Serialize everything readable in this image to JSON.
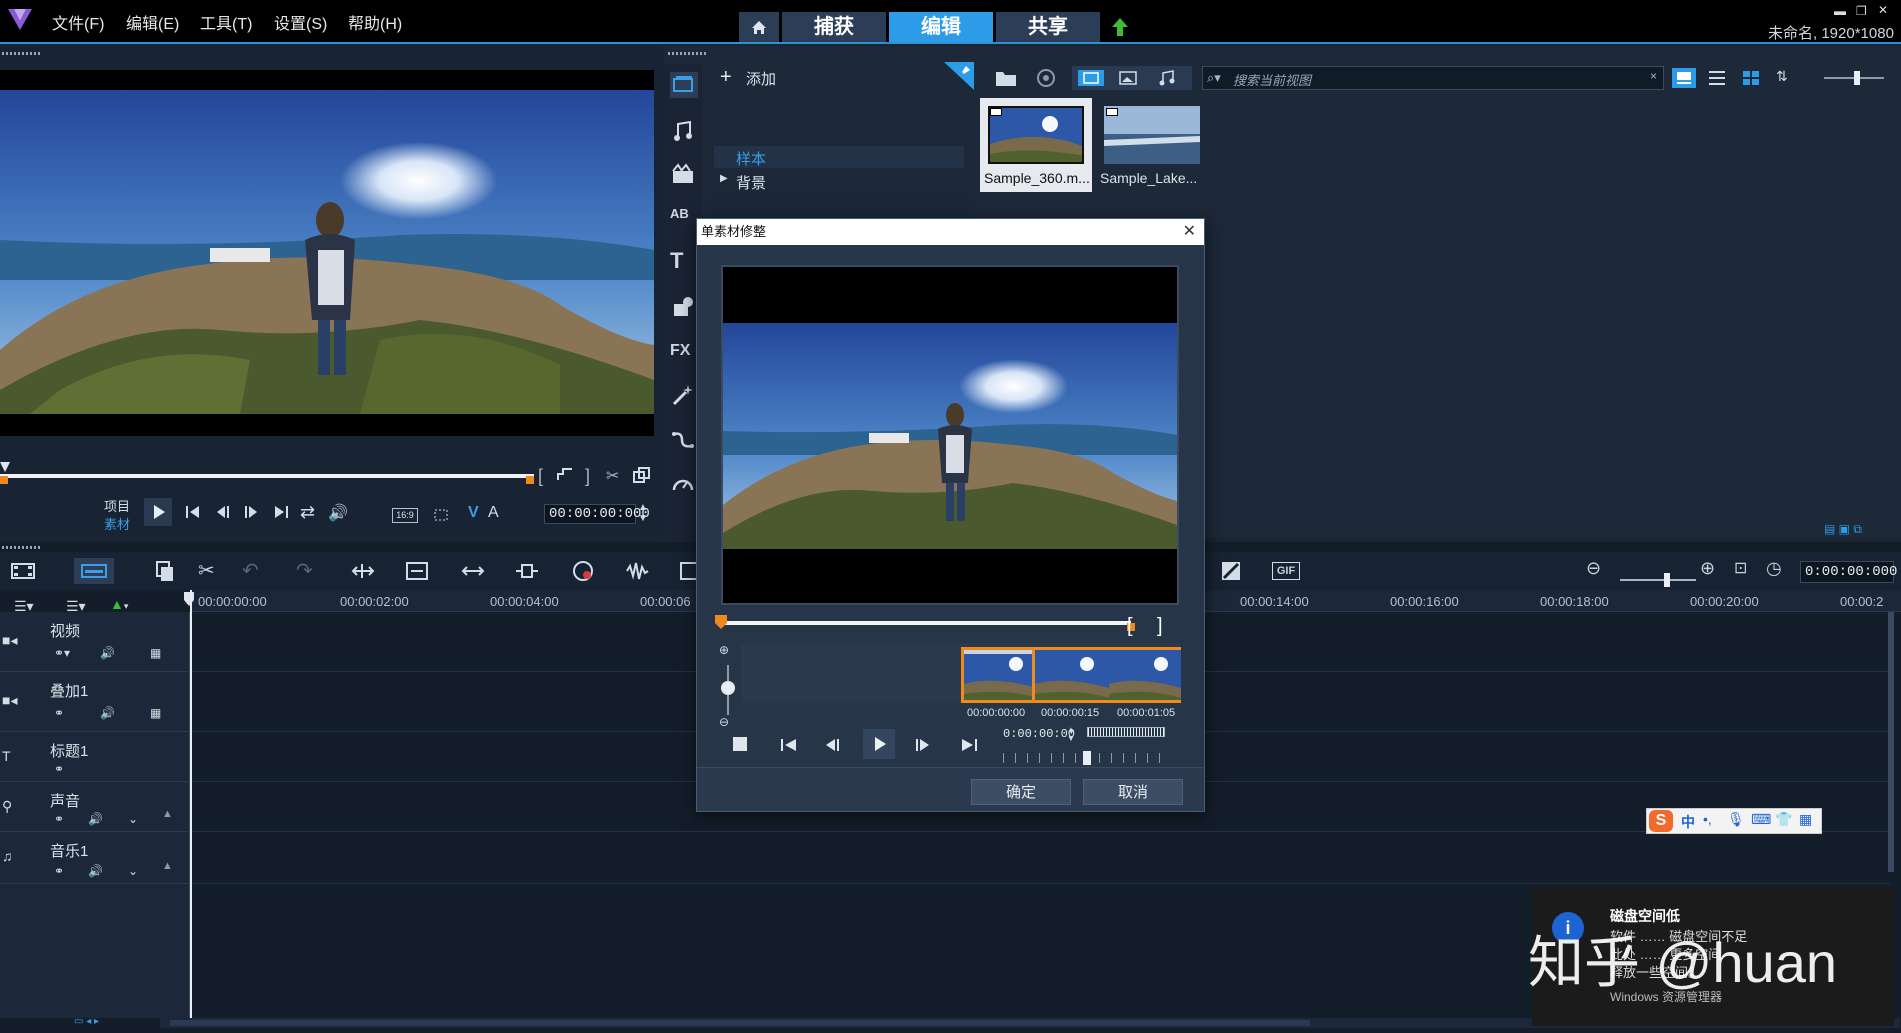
{
  "menu": {
    "items": [
      "文件(F)",
      "编辑(E)",
      "工具(T)",
      "设置(S)",
      "帮助(H)"
    ],
    "modes": {
      "capture": "捕获",
      "edit": "编辑",
      "share": "共享"
    },
    "project_info": "未命名, 1920*1080"
  },
  "player": {
    "project_label": "项目",
    "clip_label": "素材",
    "timecode": "00:00:00:000",
    "aspect_label": "16:9",
    "v_label": "V",
    "a_label": "A"
  },
  "library": {
    "add_label": "添加",
    "folders": [
      "样本",
      "背景"
    ],
    "search_placeholder": "搜索当前视图",
    "thumbs": [
      "Sample_360.m...",
      "Sample_Lake..."
    ]
  },
  "dialog": {
    "title": "单素材修整",
    "frame_times": [
      "00:00:00:00",
      "00:00:00:15",
      "00:00:01:05"
    ],
    "timecode": "0:00:00:00",
    "ok_label": "确定",
    "cancel_label": "取消"
  },
  "timeline": {
    "timecode": "0:00:00:000",
    "ruler": [
      "00:00:00:00",
      "00:00:02:00",
      "00:00:04:00",
      "00:00:06",
      "00:00:14:00",
      "00:00:16:00",
      "00:00:18:00",
      "00:00:20:00",
      "00:00:2"
    ],
    "tracks": [
      "视频",
      "叠加1",
      "标题1",
      "声音",
      "音乐1"
    ]
  },
  "ime": {
    "mode": "中"
  },
  "notification": {
    "title": "磁盘空间低",
    "line1": "软件 ……  磁盘空间不足",
    "line2": "此处 ……  更多空间",
    "line3": "释放一些空间。",
    "source": "Windows 资源管理器"
  },
  "watermark": "知乎 @huan",
  "colors": {
    "accent": "#2c9be8",
    "orange": "#f08a1e",
    "bg": "#1a2433"
  }
}
